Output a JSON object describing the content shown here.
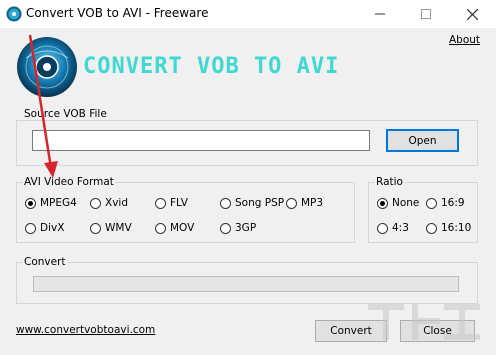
{
  "window": {
    "title": "Convert VOB to AVI - Freeware"
  },
  "about_label": "About",
  "logo": {
    "text": "CONVERT VOB TO AVI"
  },
  "source": {
    "group_label": "Source VOB File",
    "value": "",
    "open_label": "Open"
  },
  "format": {
    "group_label": "AVI Video Format",
    "options": [
      "MPEG4",
      "Xvid",
      "FLV",
      "Song PSP",
      "MP3",
      "DivX",
      "WMV",
      "MOV",
      "3GP"
    ],
    "selected": "MPEG4"
  },
  "ratio": {
    "group_label": "Ratio",
    "options": [
      "None",
      "16:9",
      "4:3",
      "16:10"
    ],
    "selected": "None"
  },
  "convert": {
    "group_label": "Convert",
    "progress_fraction": 0
  },
  "footer": {
    "website": "www.convertvobtoavi.com",
    "convert_label": "Convert",
    "close_label": "Close"
  },
  "colors": {
    "logo_text": "#40d8d2",
    "arrow": "#d6262b",
    "accent_border": "#0078d7"
  }
}
